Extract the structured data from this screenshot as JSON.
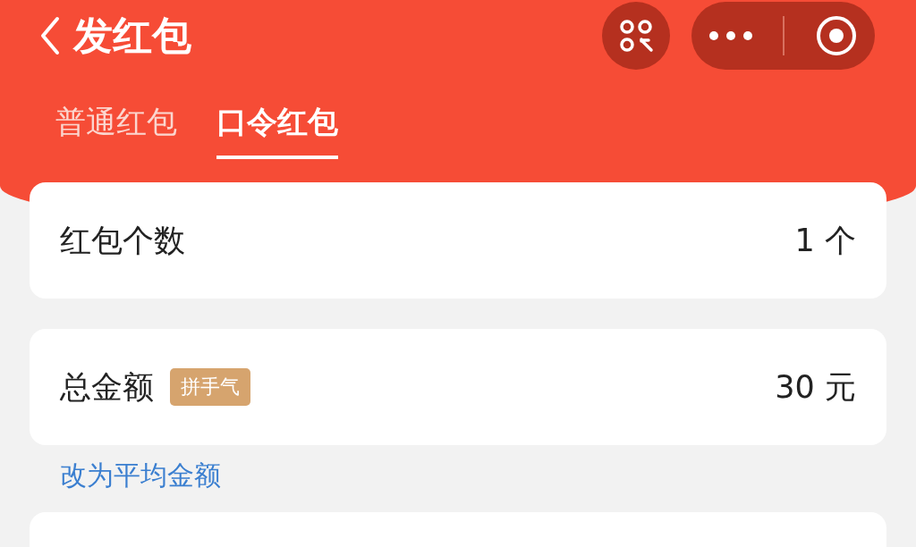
{
  "header": {
    "title": "发红包"
  },
  "tabs": [
    {
      "label": "普通红包",
      "selected": false
    },
    {
      "label": "口令红包",
      "selected": true
    }
  ],
  "fields": [
    {
      "label": "红包个数",
      "value": "1",
      "unit": "个"
    },
    {
      "label": "总金额",
      "tag": "拼手气",
      "value": "30",
      "unit": "元"
    }
  ],
  "link": "改为平均金额"
}
